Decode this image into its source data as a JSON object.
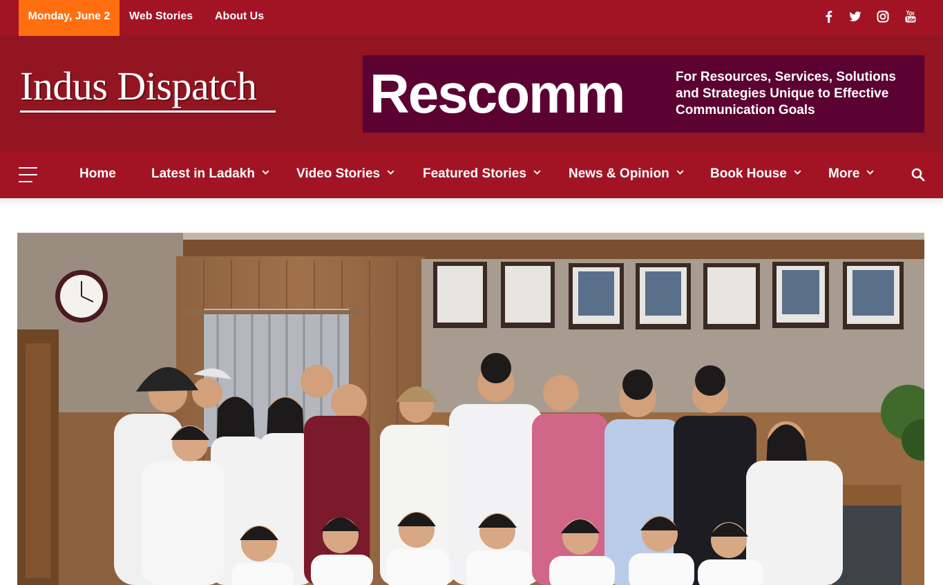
{
  "topbar": {
    "date": "Monday, June 2",
    "links": [
      "Web Stories",
      "About Us"
    ],
    "social": [
      "facebook-icon",
      "twitter-icon",
      "instagram-icon",
      "youtube-icon"
    ]
  },
  "header": {
    "logo_text": "Indus Dispatch",
    "ad": {
      "brand": "Rescomm",
      "tagline": "For Resources, Services, Solutions and Strategies Unique to Effective Communication Goals"
    }
  },
  "nav": {
    "items": [
      {
        "label": "Home",
        "has_dropdown": false
      },
      {
        "label": "Latest in Ladakh",
        "has_dropdown": true
      },
      {
        "label": "Video Stories",
        "has_dropdown": true
      },
      {
        "label": "Featured Stories",
        "has_dropdown": true
      },
      {
        "label": "News & Opinion",
        "has_dropdown": true
      },
      {
        "label": "Book House",
        "has_dropdown": true
      },
      {
        "label": "More",
        "has_dropdown": true
      }
    ]
  },
  "colors": {
    "topbar": "#a21424",
    "header": "#931521",
    "date_badge": "#ff6f0f",
    "ad_background": "#5c0232"
  }
}
